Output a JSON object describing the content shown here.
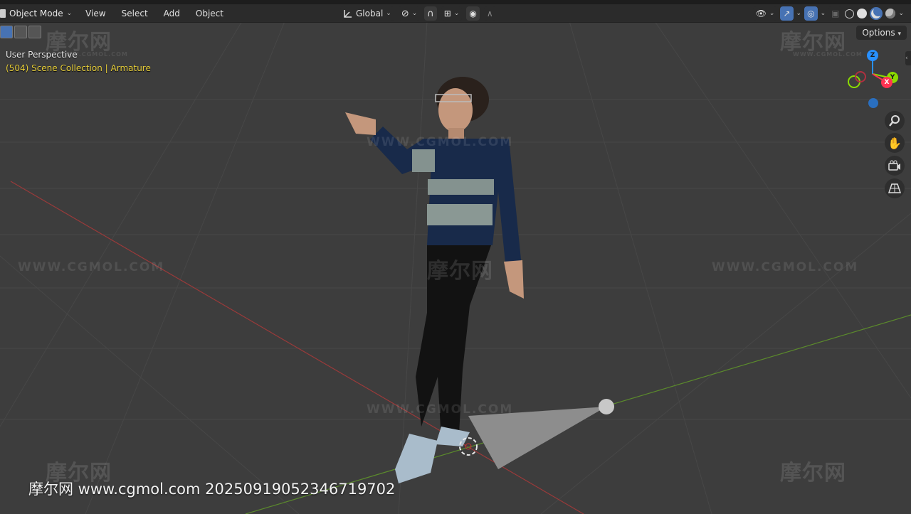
{
  "header": {
    "mode_label": "Object Mode",
    "menus": [
      "View",
      "Select",
      "Add",
      "Object"
    ],
    "transform_orientation": "Global"
  },
  "options_label": "Options",
  "viewport": {
    "perspective_label": "User Perspective",
    "collection_label": "(504) Scene Collection | Armature"
  },
  "gizmo": {
    "z": "Z",
    "y": "Y",
    "x": "X"
  },
  "nav_icons": [
    "zoom-icon",
    "hand-pan-icon",
    "camera-icon",
    "grid-ortho-icon"
  ],
  "watermark": {
    "cn_logo": "摩尔网",
    "cn_small": "WWW.CGMOL.COM",
    "url": "WWW.CGMOL.COM",
    "bottom_text": "摩尔网 www.cgmol.com 20250919052346719702"
  },
  "colors": {
    "header_bg": "#2b2b2b",
    "viewport_bg": "#3d3d3d",
    "active_blue": "#4772b3",
    "collection_yellow": "#e8cf3a",
    "axis_x": "#ff3352",
    "axis_y": "#8bdc00",
    "axis_z": "#2890ff"
  }
}
